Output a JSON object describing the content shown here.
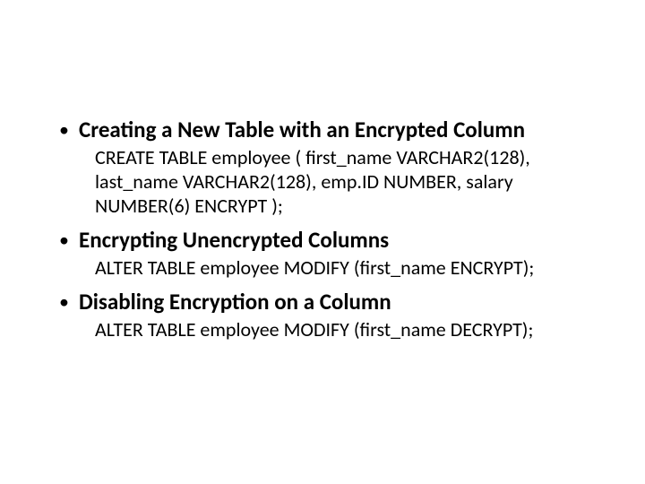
{
  "bullets": [
    {
      "heading": "Creating a New Table with an Encrypted Column",
      "code": "CREATE TABLE employee ( first_name VARCHAR2(128), last_name VARCHAR2(128), emp.ID NUMBER, salary NUMBER(6) ENCRYPT );"
    },
    {
      "heading": "Encrypting Unencrypted Columns",
      "code": "ALTER TABLE employee MODIFY (first_name ENCRYPT);"
    },
    {
      "heading": "Disabling Encryption on a Column",
      "code": "ALTER TABLE employee MODIFY (first_name DECRYPT);"
    }
  ]
}
